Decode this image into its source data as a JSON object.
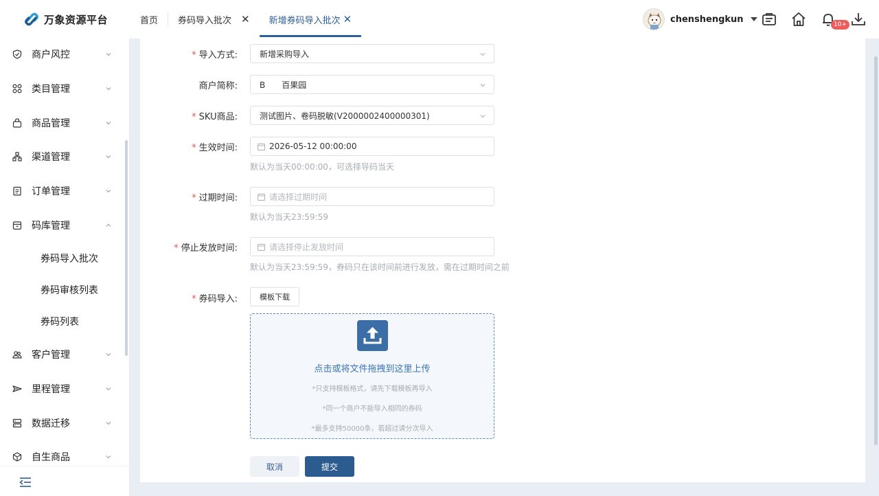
{
  "app": {
    "name": "万象资源平台",
    "brand_color": "#2d5f9a"
  },
  "tabs": [
    {
      "label": "首页",
      "closable": false
    },
    {
      "label": "券码导入批次",
      "closable": true
    },
    {
      "label": "新增券码导入批次",
      "closable": true,
      "active": true
    }
  ],
  "user": {
    "name": "chenshengkun"
  },
  "notifications": {
    "badge": "10+"
  },
  "sidebar": {
    "items": [
      {
        "label": "商户风控",
        "icon": "shield-icon",
        "expanded": false
      },
      {
        "label": "类目管理",
        "icon": "grid-icon",
        "expanded": false
      },
      {
        "label": "商品管理",
        "icon": "bag-icon",
        "expanded": false
      },
      {
        "label": "渠道管理",
        "icon": "network-icon",
        "expanded": false
      },
      {
        "label": "订单管理",
        "icon": "document-icon",
        "expanded": false
      },
      {
        "label": "码库管理",
        "icon": "box-icon",
        "expanded": true
      },
      {
        "label": "客户管理",
        "icon": "users-icon",
        "expanded": false
      },
      {
        "label": "里程管理",
        "icon": "plane-icon",
        "expanded": false
      },
      {
        "label": "数据迁移",
        "icon": "server-icon",
        "expanded": false
      },
      {
        "label": "自生商品",
        "icon": "cube-icon",
        "expanded": false
      }
    ],
    "sub_items": [
      "券码导入批次",
      "券码审核列表",
      "券码列表"
    ]
  },
  "form": {
    "import_method": {
      "label": "导入方式:",
      "value": "新增采购导入"
    },
    "merchant": {
      "label": "商户简称:",
      "value": "B　　百果园"
    },
    "sku": {
      "label": "SKU商品:",
      "value": "测试图片、卷码脱敏(V2000002400000301)"
    },
    "effective_time": {
      "label": "生效时间:",
      "value": "2026-05-12 00:00:00",
      "hint": "默认为当天00:00:00，可选择导码当天"
    },
    "expire_time": {
      "label": "过期时间:",
      "placeholder": "请选择过期时间",
      "hint": "默认为当天23:59:59"
    },
    "stop_time": {
      "label": "停止发放时间:",
      "placeholder": "请选择停止发放时间",
      "hint": "默认为当天23:59:59，券码只在该时间前进行发放，需在过期时间之前"
    },
    "code_import": {
      "label": "券码导入:",
      "template_button": "模板下载",
      "upload_text": "点击或将文件拖拽到这里上传",
      "notes": [
        "*只支持模板格式，请先下载模板再导入",
        "*同一个商户不能导入相同的券码",
        "*最多支持50000条，若超过请分次导入"
      ]
    },
    "cancel_label": "取消",
    "submit_label": "提交"
  }
}
